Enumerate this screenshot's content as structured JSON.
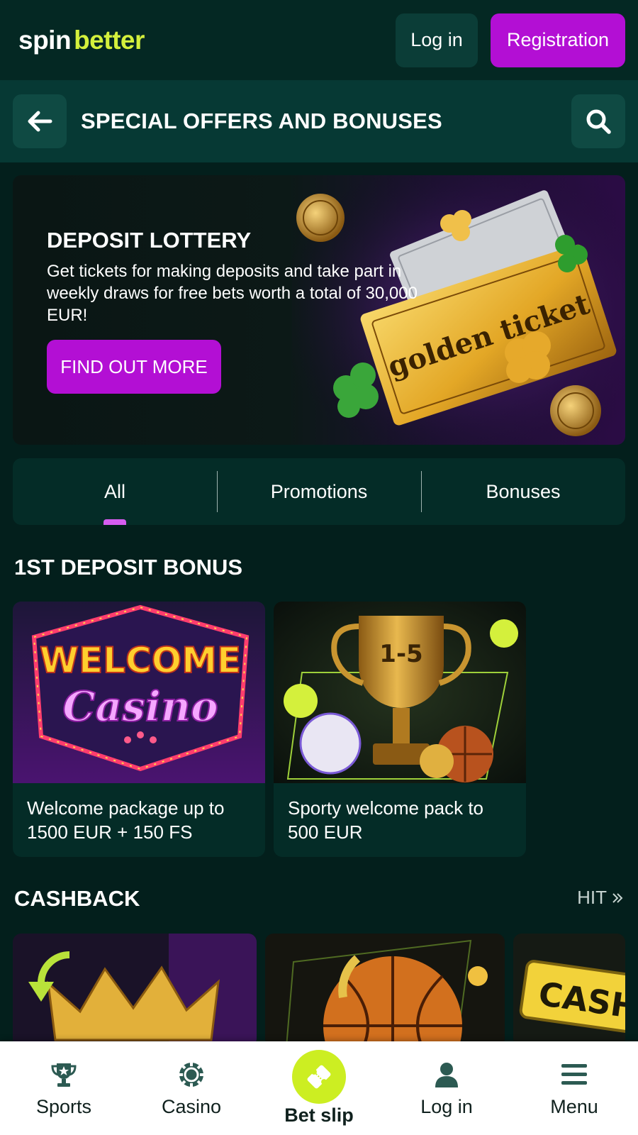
{
  "header": {
    "logo_part1": "spin",
    "logo_part2": "better",
    "login_label": "Log in",
    "register_label": "Registration"
  },
  "subheader": {
    "title": "SPECIAL OFFERS AND BONUSES"
  },
  "banner": {
    "title": "DEPOSIT LOTTERY",
    "text": "Get tickets for making deposits and take part in weekly draws for free bets worth a total of 30,000 EUR!",
    "button_label": "FIND OUT MORE",
    "ticket_text": "golden ticket"
  },
  "tabs": [
    {
      "label": "All",
      "active": true
    },
    {
      "label": "Promotions",
      "active": false
    },
    {
      "label": "Bonuses",
      "active": false
    }
  ],
  "section_deposit": {
    "title": "1ST DEPOSIT BONUS",
    "cards": [
      {
        "text": "Welcome package up to 1500 EUR + 150 FS",
        "img_line1": "WELCOME",
        "img_line2": "Casino"
      },
      {
        "text": "Sporty welcome pack to 500 EUR",
        "img_label": "1-5"
      }
    ]
  },
  "section_cashback": {
    "title": "CASHBACK",
    "link_label": "HIT",
    "card3_text": "CASH"
  },
  "bottom_nav": [
    {
      "label": "Sports",
      "icon": "trophy-icon"
    },
    {
      "label": "Casino",
      "icon": "chip-icon"
    },
    {
      "label": "Bet slip",
      "icon": "ticket-icon"
    },
    {
      "label": "Log in",
      "icon": "user-icon"
    },
    {
      "label": "Menu",
      "icon": "menu-icon"
    }
  ],
  "colors": {
    "background": "#031f1c",
    "accent_purple": "#b30fd4",
    "accent_lime": "#ccee22",
    "panel": "#042c27"
  }
}
